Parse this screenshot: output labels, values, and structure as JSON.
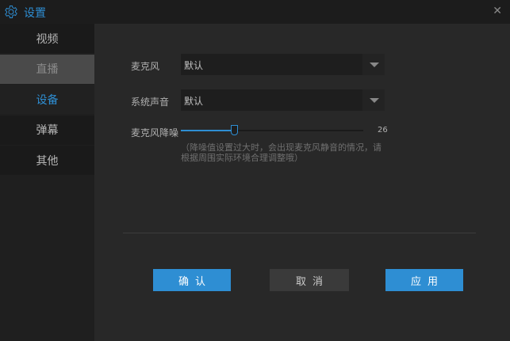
{
  "window": {
    "title": "设置",
    "icon": "gear-icon",
    "close": "✕"
  },
  "sidebar": {
    "items": [
      {
        "label": "视频",
        "state": "normal"
      },
      {
        "label": "直播",
        "state": "hover"
      },
      {
        "label": "设备",
        "state": "active"
      },
      {
        "label": "弹幕",
        "state": "normal"
      },
      {
        "label": "其他",
        "state": "normal"
      }
    ]
  },
  "device": {
    "mic_label": "麦克风",
    "mic_value": "默认",
    "sys_label": "系统声音",
    "sys_value": "默认",
    "noise_label": "麦克风降噪",
    "noise_value": 26,
    "noise_display": "26",
    "noise_max": 100,
    "hint": "（降噪值设置过大时，会出现麦克风静音的情况，请根据周围实际环境合理调整哦）"
  },
  "buttons": {
    "confirm": "确认",
    "cancel": "取消",
    "apply": "应用"
  },
  "colors": {
    "accent": "#2e8ed3",
    "background": "#282828"
  }
}
